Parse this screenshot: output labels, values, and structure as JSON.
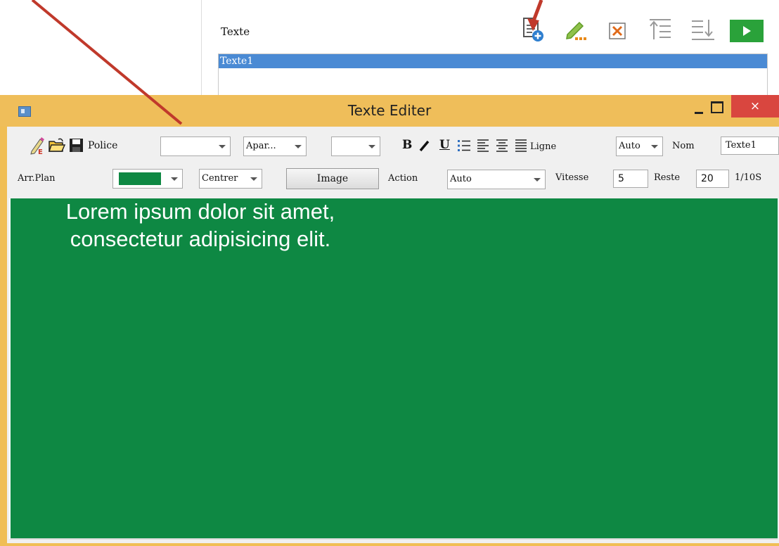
{
  "background_panel": {
    "texts_label": "Texte",
    "list_items": [
      "Texte1"
    ],
    "toolbar_icons": [
      "add-document-icon",
      "edit-pencil-icon",
      "delete-x-icon",
      "move-up-icon",
      "move-down-icon",
      "play-icon"
    ]
  },
  "window": {
    "title": "Texte Editer",
    "close_glyph": "×"
  },
  "toolbar1": {
    "font_label": "Police",
    "font_value": "",
    "style_value": "Apar...",
    "size_value": "",
    "line_label": "Ligne",
    "line_value": "Auto",
    "name_label": "Nom",
    "name_value": "Texte1",
    "bold_glyph": "B",
    "italic_glyph": "/",
    "underline_glyph": "U"
  },
  "toolbar2": {
    "bg_label": "Arr.Plan",
    "bg_color": "#0e8843",
    "align_value": "Centrer",
    "image_button": "Image",
    "action_label": "Action",
    "action_value": "Auto",
    "speed_label": "Vitesse",
    "speed_value": "5",
    "remain_label": "Reste",
    "remain_value": "20",
    "unit_label": "1/10S"
  },
  "canvas": {
    "background": "#0e8843",
    "text_lines": [
      "Lorem ipsum dolor sit amet,",
      "consectetur adipisicing elit."
    ]
  },
  "annotations": {
    "arrow_color": "#c0392b"
  }
}
